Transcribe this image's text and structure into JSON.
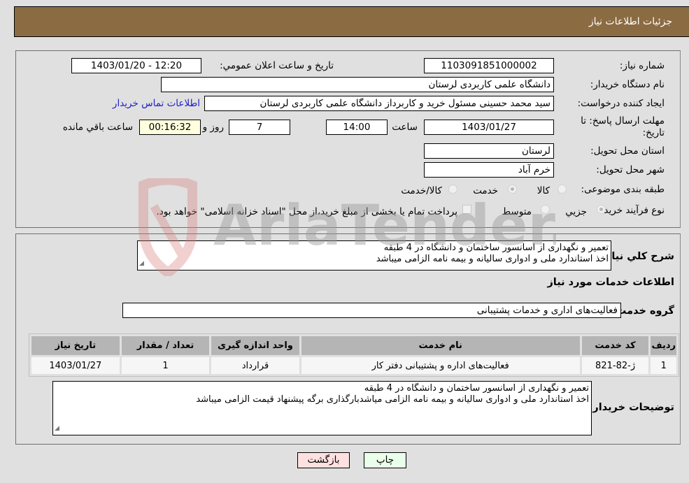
{
  "header": {
    "title": "جزئیات اطلاعات نیاز"
  },
  "details": {
    "need_number_label": "شماره نیاز:",
    "need_number": "1103091851000002",
    "announce_label": "تاریخ و ساعت اعلان عمومي:",
    "announce_value": "1403/01/20 - 12:20",
    "buyer_org_label": "نام دستگاه خریدار:",
    "buyer_org": "دانشگاه علمی کاربردی لرستان",
    "creator_label": "ایجاد کننده درخواست:",
    "creator": "سید محمد حسینی مسئول خرید و کاربرداز دانشگاه علمی کاربردی لرستان",
    "contact_link": "اطلاعات تماس خریدار",
    "deadline_label": "مهلت ارسال پاسخ: تا تاریخ:",
    "deadline_date": "1403/01/27",
    "time_label": "ساعت",
    "deadline_time": "14:00",
    "days_value": "7",
    "days_label": "روز و",
    "remaining_time": "00:16:32",
    "remaining_label": "ساعت باقي مانده",
    "province_label": "استان محل تحویل:",
    "province": "لرستان",
    "city_label": "شهر محل تحویل:",
    "city": "خرم آباد",
    "category_label": "طبقه بندی موضوعی:",
    "category_options": [
      {
        "label": "کالا",
        "selected": false
      },
      {
        "label": "خدمت",
        "selected": true
      },
      {
        "label": "کالا/خدمت",
        "selected": false
      }
    ],
    "process_label": "نوع فرآیند خرید :",
    "process_options": [
      {
        "label": "جزيي",
        "selected": true
      },
      {
        "label": "متوسط",
        "selected": false
      }
    ],
    "treasury_note": "پرداخت تمام یا بخشی از مبلغ خرید،از محل \"اسناد خزانه اسلامی\" خواهد بود.",
    "treasury_checked": false
  },
  "summary": {
    "label": "شرح کلي نیاز:",
    "line1": "تعمیر و نگهداری از اسانسور ساختمان و دانشگاه در 4 طبقه",
    "line2": "اخذ استاندارد ملی  و ادواری سالیانه  و بیمه نامه الزامی میباشد"
  },
  "services": {
    "section_title": "اطلاعات خدمات مورد نیاز",
    "group_label": "گروه خدمت:",
    "group_value": "فعالیت‌های اداری و خدمات پشتیبانی",
    "columns": [
      "ردیف",
      "کد خدمت",
      "نام خدمت",
      "واحد اندازه گیری",
      "تعداد / مقدار",
      "تاریخ نیاز"
    ],
    "rows": [
      [
        "1",
        "ژ-82-821",
        "فعالیت‌های اداره و پشتیبانی دفتر کار",
        "قرارداد",
        "1",
        "1403/01/27"
      ]
    ]
  },
  "buyer_notes": {
    "label": "توضیحات خریدار:",
    "line1": "تعمیر و نگهداری از اسانسور ساختمان و دانشگاه در 4 طبقه",
    "line2": "اخذ استاندارد ملی  و ادواری سالیانه  و بیمه نامه الزامی میاشدبارگذاری برگه پیشنهاد قیمت الزامی میباشد"
  },
  "buttons": {
    "print": "چاپ",
    "back": "بازگشت"
  },
  "watermark": {
    "text": "AriaTender.neT"
  },
  "colors": {
    "header_bg": "#8b6b42",
    "print_bg": "#eaffea",
    "back_bg": "#ffe0e0",
    "link": "#2020c8"
  }
}
